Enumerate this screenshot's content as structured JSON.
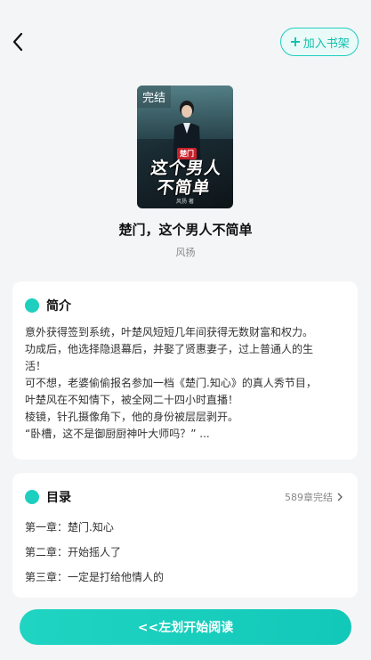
{
  "header": {
    "add_shelf_label": "加入书架"
  },
  "book": {
    "cover": {
      "status_tag": "完结",
      "series_tag": "楚门",
      "title_line1": "这个男人",
      "title_line2": "不简单",
      "author": "风扬 著"
    },
    "title": "楚门，这个男人不简单",
    "author": "风扬"
  },
  "intro": {
    "heading": "简介",
    "lines": [
      "意外获得签到系统，叶楚风短短几年间获得无数财富和权力。",
      "功成后，他选择隐退幕后，并娶了贤惠妻子，过上普通人的生",
      "活！",
      "可不想，老婆偷偷报名参加一档《楚门.知心》的真人秀节目，",
      "叶楚风在不知情下，被全网二十四小时直播！",
      "棱镜，针孔摄像角下，他的身份被层层剥开。",
      "“卧槽，这不是御厨厨神叶大师吗？” ..."
    ]
  },
  "toc": {
    "heading": "目录",
    "meta": "589章完结",
    "chapters": [
      "第一章：楚门.知心",
      "第二章：开始摇人了",
      "第三章：一定是打给他情人的"
    ]
  },
  "cta": {
    "label": "<<左划开始阅读"
  },
  "colors": {
    "accent": "#1ecfbf"
  }
}
